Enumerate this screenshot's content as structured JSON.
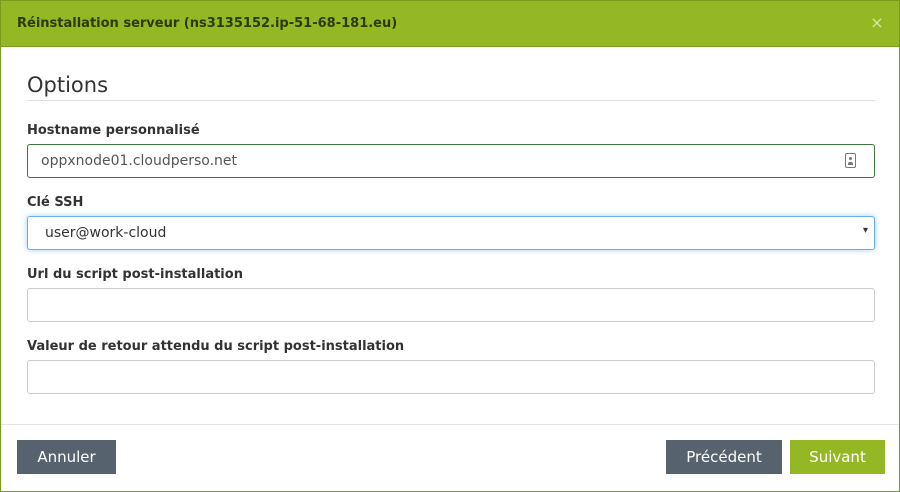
{
  "modal": {
    "title": "Réinstallation serveur (ns3135152.ip-51-68-181.eu)",
    "close_symbol": "×"
  },
  "options": {
    "section_title": "Options",
    "hostname": {
      "label": "Hostname personnalisé",
      "value": "oppxnode01.cloudperso.net",
      "icon": "contact-card-icon"
    },
    "ssh_key": {
      "label": "Clé SSH",
      "selected": "user@work-cloud",
      "arrow": "▾"
    },
    "script_url": {
      "label": "Url du script post-installation",
      "value": ""
    },
    "script_return": {
      "label": "Valeur de retour attendu du script post-installation",
      "value": ""
    }
  },
  "footer": {
    "cancel_label": "Annuler",
    "previous_label": "Précédent",
    "next_label": "Suivant"
  },
  "colors": {
    "header": "#93b824",
    "next_button": "#93b824",
    "neutral_button": "#56626d",
    "valid_border": "#3c763d",
    "focus_border": "#66afe9"
  }
}
